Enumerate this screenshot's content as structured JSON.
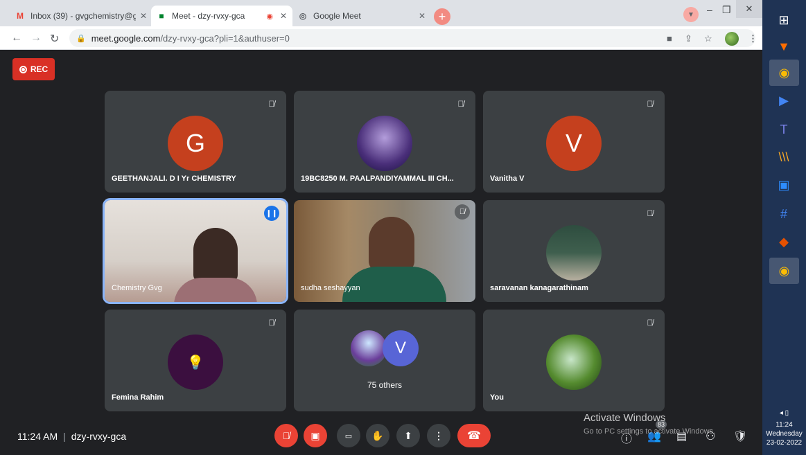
{
  "browser": {
    "tabs": [
      {
        "title": "Inbox (39) - gvgchemistry@gvgv",
        "icon": "gmail-icon"
      },
      {
        "title": "Meet - dzy-rvxy-gca",
        "icon": "meet-icon",
        "recording": true
      },
      {
        "title": "Google Meet",
        "icon": "meet-globe-icon"
      }
    ],
    "new_tab_label": "+",
    "url_host": "meet.google.com",
    "url_path": "/dzy-rvxy-gca?pli=1&authuser=0"
  },
  "meet": {
    "rec_label": "REC",
    "tiles": [
      {
        "name": "GEETHANJALI. D I Yr CHEMISTRY",
        "avatar_letter": "G",
        "avatar_color": "#c5401e"
      },
      {
        "name": "19BC8250 M. PAALPANDIYAMMAL III CH...",
        "avatar_letter": "",
        "avatar_color": "#3d2a6e"
      },
      {
        "name": "Vanitha V",
        "avatar_letter": "V",
        "avatar_color": "#c5401e"
      },
      {
        "name": "Chemistry Gvg"
      },
      {
        "name": "sudha seshayyan"
      },
      {
        "name": "saravanan kanagarathinam"
      },
      {
        "name": "Femina Rahim"
      },
      {
        "name": "75 others",
        "avatar_letter": "V",
        "avatar_color": "#5865d6"
      },
      {
        "name": "You"
      }
    ],
    "time": "11:24 AM",
    "meeting_code": "dzy-rvxy-gca",
    "participants_count": "83",
    "activate_title": "Activate Windows",
    "activate_sub": "Go to PC settings to activate Windows."
  },
  "taskbar": {
    "time": "11:24",
    "day": "Wednesday",
    "date": "23-02-2022"
  }
}
